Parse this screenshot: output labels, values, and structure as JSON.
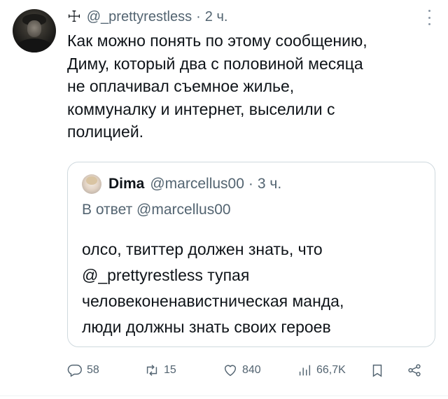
{
  "header": {
    "cross_glyph": "☩",
    "handle": "@_prettyrestless",
    "separator": "·",
    "time": "2 ч."
  },
  "tweet": {
    "text": "Как можно понять по этому сообщению,\nДиму, который два с половиной месяца\nне оплачивал съемное жилье,\nкоммуналку и интернет, выселили с\nполицией."
  },
  "quote": {
    "name": "Dima",
    "handle": "@marcellus00",
    "separator": "·",
    "time": "3 ч.",
    "reply_to": "В ответ @marcellus00",
    "text": "олсо, твиттер должен знать, что\n@_prettyrestless тупая\nчеловеконенавистническая манда,\nлюди должны знать своих героев"
  },
  "actions": {
    "replies": "58",
    "retweets": "15",
    "likes": "840",
    "views": "66,7K"
  },
  "icons": {
    "reply": "reply-icon",
    "retweet": "retweet-icon",
    "like": "heart-icon",
    "views": "views-icon",
    "bookmark": "bookmark-icon",
    "share": "share-icon",
    "more": "more-vertical-icon"
  }
}
